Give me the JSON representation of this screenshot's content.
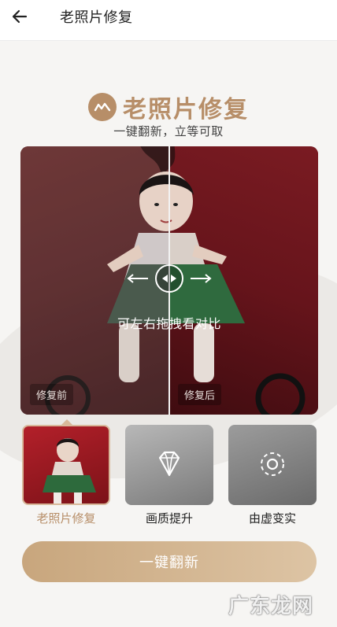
{
  "header": {
    "title": "老照片修复",
    "back_icon": "arrow-left-icon"
  },
  "brand": {
    "title": "老照片修复",
    "subtitle": "一键翻新，立等可取",
    "logo_icon": "brand-logo-icon",
    "accent": "#b78e68"
  },
  "compare": {
    "hint": "可左右拖拽看对比",
    "before_label": "修复前",
    "after_label": "修复后",
    "handle_icon": "drag-handle-icon"
  },
  "features": [
    {
      "label": "老照片修复",
      "selected": true,
      "icon": "photo-thumbnail"
    },
    {
      "label": "画质提升",
      "selected": false,
      "icon": "diamond-icon"
    },
    {
      "label": "由虚变实",
      "selected": false,
      "icon": "focus-icon"
    }
  ],
  "cta": {
    "label": "一键翻新",
    "color": "#c8a67d"
  },
  "watermark": "广东龙网"
}
